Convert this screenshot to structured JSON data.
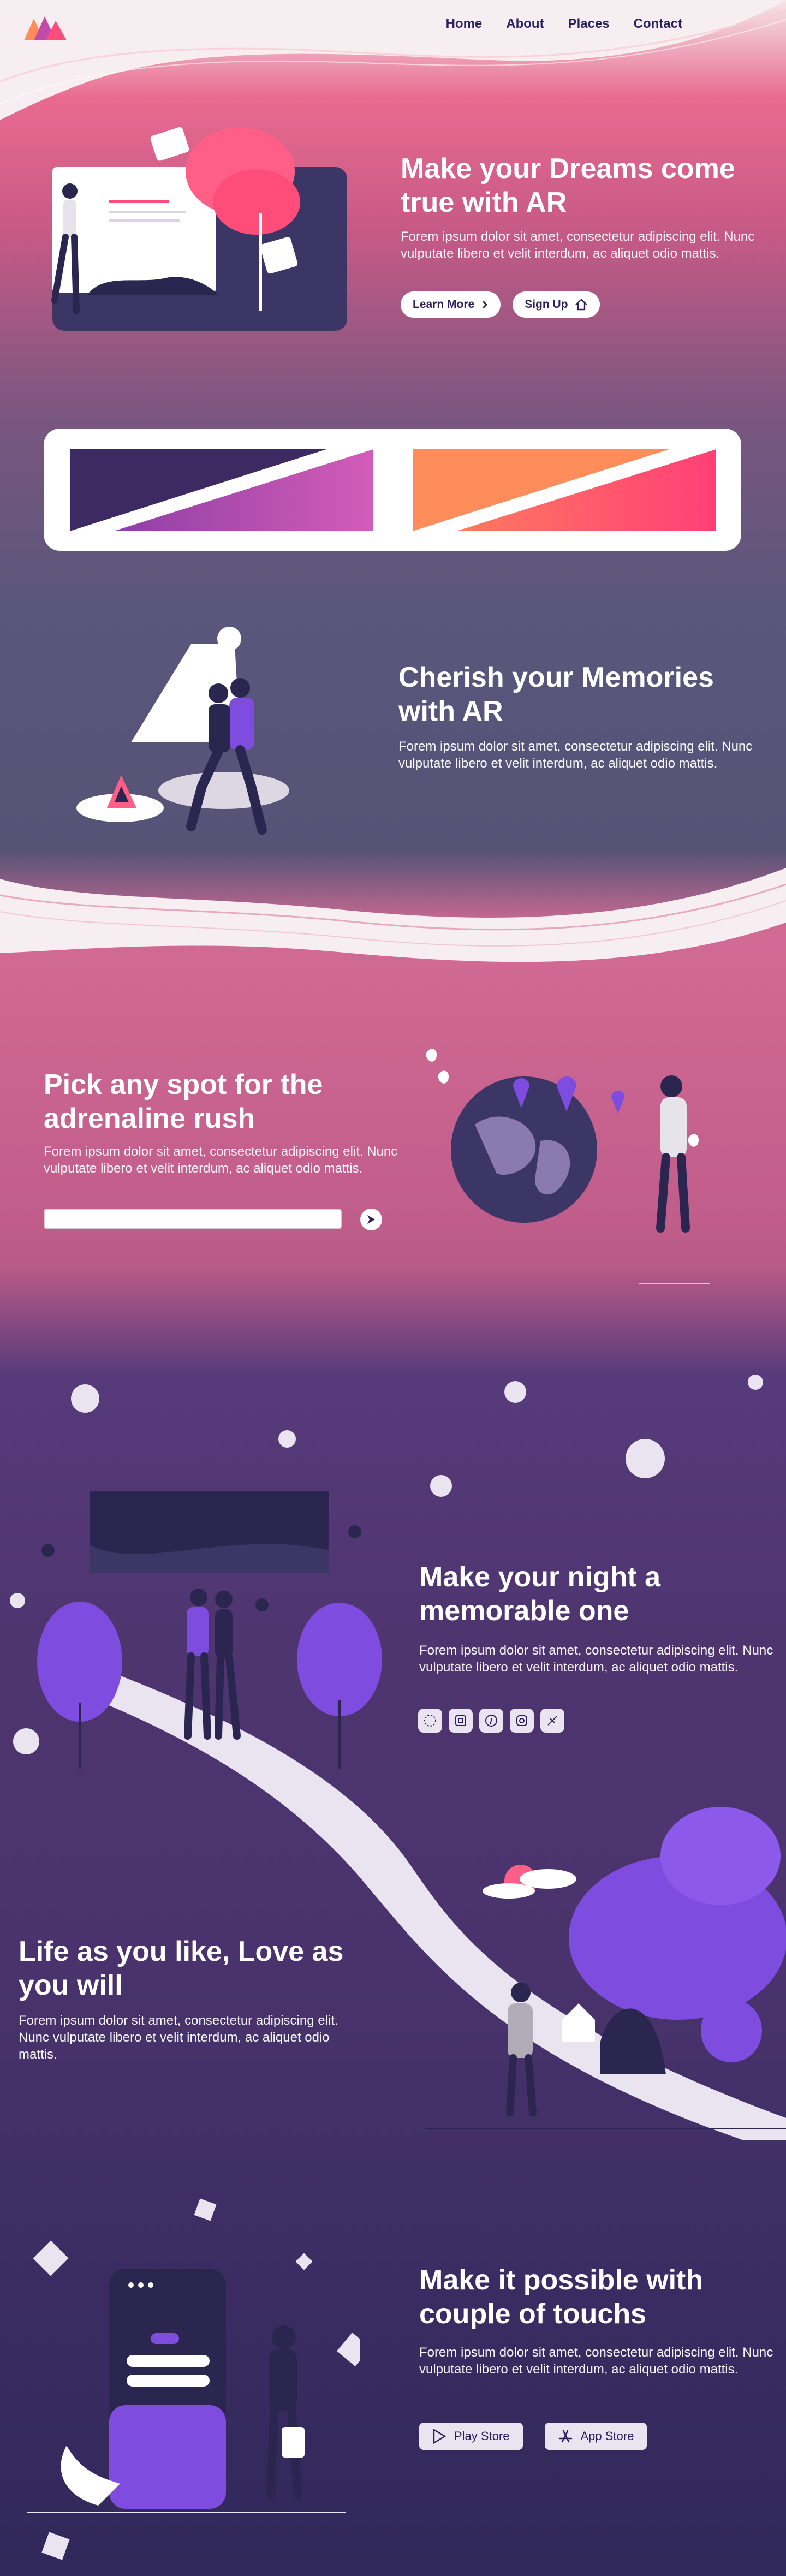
{
  "nav": {
    "links": [
      "Home",
      "About",
      "Places",
      "Contact"
    ]
  },
  "hero": {
    "title": "Make your Dreams come true with AR",
    "body": "Forem ipsum dolor sit amet, consectetur adipiscing elit. Nunc vulputate libero et velit interdum, ac aliquet odio mattis.",
    "learn_more": "Learn More",
    "sign_up": "Sign Up"
  },
  "memories": {
    "title": "Cherish your Memories with AR",
    "body": "Forem ipsum dolor sit amet, consectetur adipiscing elit. Nunc vulputate libero et velit interdum, ac aliquet odio mattis."
  },
  "spot": {
    "title": "Pick any spot for the adrenaline rush",
    "body": "Forem ipsum dolor sit amet, consectetur adipiscing elit. Nunc vulputate libero et velit interdum, ac aliquet odio mattis.",
    "input_value": ""
  },
  "night": {
    "title": "Make your night a memorable one",
    "body": "Forem ipsum dolor sit amet, consectetur adipiscing elit. Nunc vulputate libero et velit interdum, ac aliquet odio mattis.",
    "social_icons": [
      "dribbble-icon",
      "behance-icon",
      "pinterest-icon",
      "instagram-icon",
      "codepen-icon"
    ]
  },
  "life": {
    "title": "Life as you like, Love as you will",
    "body": "Forem ipsum dolor sit amet, consectetur adipiscing elit. Nunc vulputate libero et velit interdum, ac aliquet odio mattis."
  },
  "touch": {
    "title": "Make it possible with couple of touchs",
    "body": "Forem ipsum dolor sit amet, consectetur adipiscing elit. Nunc vulputate libero et velit interdum, ac aliquet odio mattis.",
    "play_store": "Play Store",
    "app_store": "App Store"
  },
  "colors": {
    "brand": "#2c1f5b",
    "pink": "#ff4d7a",
    "purple": "#7e4de0",
    "orange": "#ff8c5a"
  }
}
